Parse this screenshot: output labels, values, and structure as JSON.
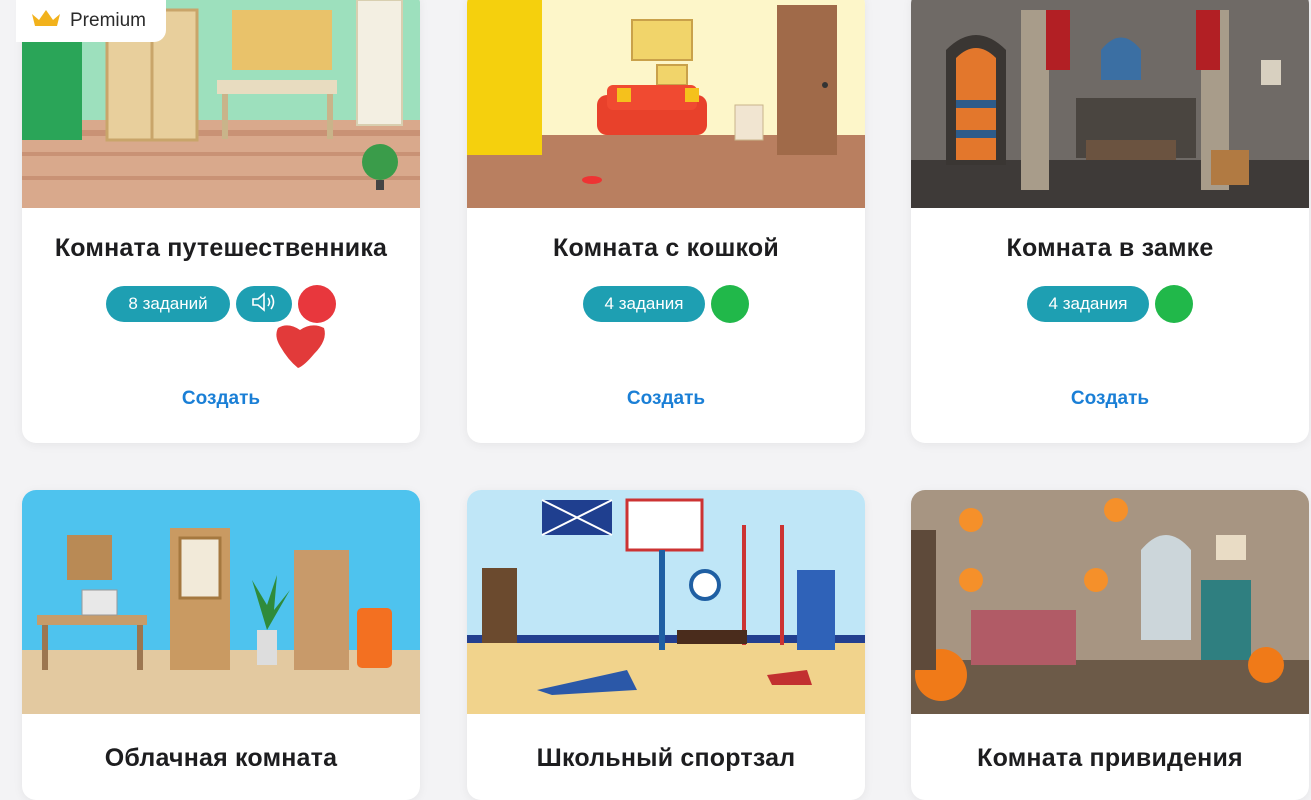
{
  "premium_badge": {
    "label": "Premium",
    "icon": "crown-icon"
  },
  "cards": [
    {
      "title": "Комната путешественника",
      "tasks": "8 заданий",
      "status": "red",
      "has_sound": true,
      "action": "Создать"
    },
    {
      "title": "Комната с кошкой",
      "tasks": "4 задания",
      "status": "green",
      "has_sound": false,
      "action": "Создать"
    },
    {
      "title": "Комната в замке",
      "tasks": "4 задания",
      "status": "green",
      "has_sound": false,
      "action": "Создать"
    },
    {
      "title": "Облачная комната"
    },
    {
      "title": "Школьный спортзал"
    },
    {
      "title": "Комната привидения"
    }
  ],
  "colors": {
    "pill": "#1e9fb2",
    "link": "#1a7fd6",
    "status_red": "#e8373d",
    "status_green": "#21b84a"
  }
}
